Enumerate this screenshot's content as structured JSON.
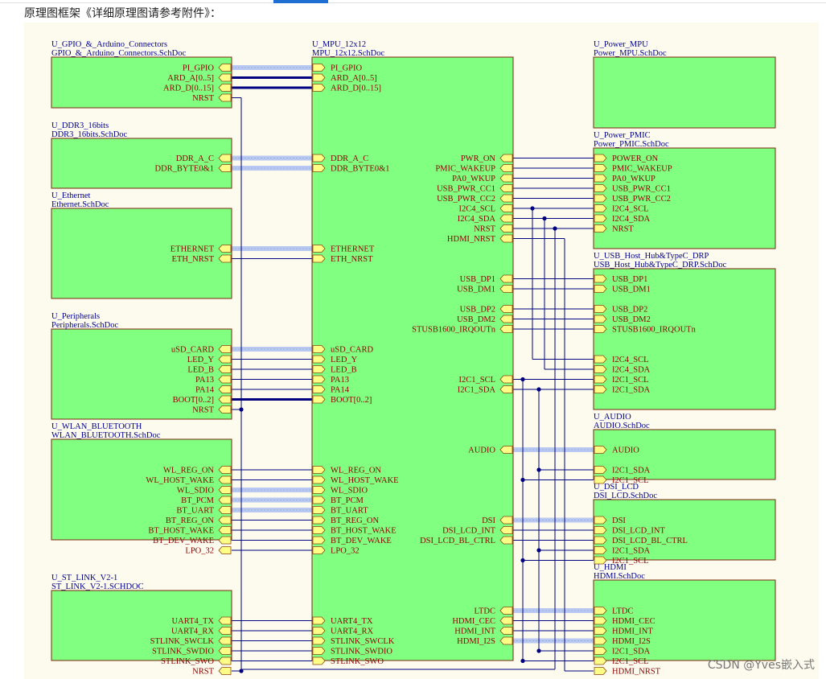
{
  "page": {
    "heading": "原理图框架《详细原理图请参考附件》：",
    "watermark": "CSDN @Yves嵌入式"
  },
  "colors": {
    "block_fill": "#80ff80",
    "block_border": "#7a2a10",
    "title_text": "#00008b",
    "pin_text": "#8b0000",
    "port_fill": "#ffff88",
    "port_border": "#8b4513",
    "wire": "#000080",
    "bus_highlight": "#b8c8f0"
  },
  "sheets": [
    {
      "id": "gpio",
      "title1": "U_GPIO_&_Arduino_Connectors",
      "title2": "GPIO_&_Arduino_Connectors.SchDoc"
    },
    {
      "id": "ddr",
      "title1": "U_DDR3_16bits",
      "title2": "DDR3_16bits.SchDoc"
    },
    {
      "id": "eth",
      "title1": "U_Ethernet",
      "title2": "Ethernet.SchDoc"
    },
    {
      "id": "per",
      "title1": "U_Peripherals",
      "title2": "Peripherals.SchDoc"
    },
    {
      "id": "wlan",
      "title1": "U_WLAN_BLUETOOTH",
      "title2": "WLAN_BLUETOOTH.SchDoc"
    },
    {
      "id": "stl",
      "title1": "U_ST_LINK_V2-1",
      "title2": "ST_LINK_V2-1.SCHDOC"
    },
    {
      "id": "mpu",
      "title1": "U_MPU_12x12",
      "title2": "MPU_12x12.SchDoc"
    },
    {
      "id": "pwr",
      "title1": "U_Power_MPU",
      "title2": "Power_MPU.SchDoc"
    },
    {
      "id": "pmic",
      "title1": "U_Power_PMIC",
      "title2": "Power_PMIC.SchDoc"
    },
    {
      "id": "usb",
      "title1": "U_USB_Host_Hub&TypeC_DRP",
      "title2": "USB_Host_Hub&TypeC_DRP.SchDoc"
    },
    {
      "id": "aud",
      "title1": "U_AUDIO",
      "title2": "AUDIO.SchDoc"
    },
    {
      "id": "dsi",
      "title1": "U_DSI_LCD",
      "title2": "DSI_LCD.SchDoc"
    },
    {
      "id": "hdmi",
      "title1": "U_HDMI",
      "title2": "HDMI.SchDoc"
    }
  ],
  "ports": {
    "gpio": [
      "PI_GPIO",
      "ARD_A[0..5]",
      "ARD_D[0..15]",
      "NRST"
    ],
    "ddr": [
      "DDR_A_C",
      "DDR_BYTE0&1"
    ],
    "eth": [
      "ETHERNET",
      "ETH_NRST"
    ],
    "per": [
      "uSD_CARD",
      "LED_Y",
      "LED_B",
      "PA13",
      "PA14",
      "BOOT[0..2]",
      "NRST"
    ],
    "wlan": [
      "WL_REG_ON",
      "WL_HOST_WAKE",
      "WL_SDIO",
      "BT_PCM",
      "BT_UART",
      "BT_REG_ON",
      "BT_HOST_WAKE",
      "BT_DEV_WAKE",
      "LPO_32"
    ],
    "stl": [
      "UART4_TX",
      "UART4_RX",
      "STLINK_SWCLK",
      "STLINK_SWDIO",
      "STLINK_SWO",
      "NRST"
    ],
    "mpu_left": [
      "PI_GPIO",
      "ARD_A[0..5]",
      "ARD_D[0..15]",
      "DDR_A_C",
      "DDR_BYTE0&1",
      "ETHERNET",
      "ETH_NRST",
      "uSD_CARD",
      "LED_Y",
      "LED_B",
      "PA13",
      "PA14",
      "BOOT[0..2]",
      "WL_REG_ON",
      "WL_HOST_WAKE",
      "WL_SDIO",
      "BT_PCM",
      "BT_UART",
      "BT_REG_ON",
      "BT_HOST_WAKE",
      "BT_DEV_WAKE",
      "LPO_32",
      "UART4_TX",
      "UART4_RX",
      "STLINK_SWCLK",
      "STLINK_SWDIO",
      "STLINK_SWO"
    ],
    "mpu_right": [
      "PWR_ON",
      "PMIC_WAKEUP",
      "PA0_WKUP",
      "USB_PWR_CC1",
      "USB_PWR_CC2",
      "I2C4_SCL",
      "I2C4_SDA",
      "NRST",
      "HDMI_NRST",
      "USB_DP1",
      "USB_DM1",
      "USB_DP2",
      "USB_DM2",
      "STUSB1600_IRQOUTn",
      "I2C1_SCL",
      "I2C1_SDA",
      "AUDIO",
      "DSI",
      "DSI_LCD_INT",
      "DSI_LCD_BL_CTRL",
      "LTDC",
      "HDMI_CEC",
      "HDMI_INT",
      "HDMI_I2S"
    ],
    "pmic": [
      "POWER_ON",
      "PMIC_WAKEUP",
      "PA0_WKUP",
      "USB_PWR_CC1",
      "USB_PWR_CC2",
      "I2C4_SCL",
      "I2C4_SDA",
      "NRST"
    ],
    "usb": [
      "USB_DP1",
      "USB_DM1",
      "USB_DP2",
      "USB_DM2",
      "STUSB1600_IRQOUTn",
      "I2C4_SCL",
      "I2C4_SDA",
      "I2C1_SCL",
      "I2C1_SDA"
    ],
    "aud": [
      "AUDIO",
      "I2C1_SDA",
      "I2C1_SCL"
    ],
    "dsi": [
      "DSI",
      "DSI_LCD_INT",
      "DSI_LCD_BL_CTRL",
      "I2C1_SDA",
      "I2C1_SCL"
    ],
    "hdmi": [
      "LTDC",
      "HDMI_CEC",
      "HDMI_INT",
      "HDMI_I2S",
      "I2C1_SDA",
      "I2C1_SCL",
      "HDMI_NRST"
    ]
  },
  "bus_ports": [
    "PI_GPIO",
    "DDR_A_C",
    "DDR_BYTE0&1",
    "ETHERNET",
    "uSD_CARD",
    "WL_SDIO",
    "BT_PCM",
    "BT_UART",
    "AUDIO",
    "DSI",
    "LTDC",
    "HDMI_I2S"
  ],
  "thick_buses": [
    "ARD_A[0..5]",
    "ARD_D[0..15]",
    "BOOT[0..2]"
  ]
}
